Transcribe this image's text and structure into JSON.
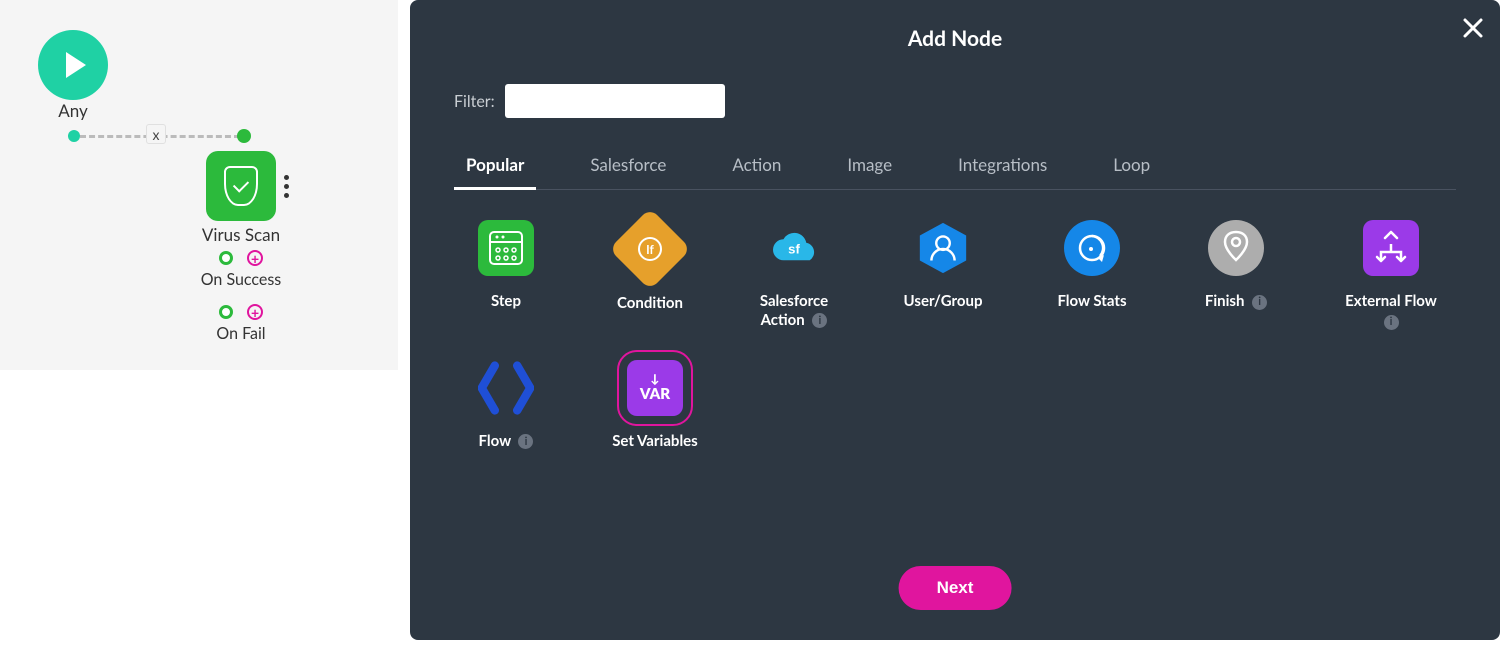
{
  "canvas": {
    "start_label": "Any",
    "connector_x": "x",
    "node_label": "Virus Scan",
    "on_success": "On Success",
    "on_fail": "On Fail"
  },
  "modal": {
    "title": "Add Node",
    "filter_label": "Filter:",
    "filter_value": "",
    "tabs": {
      "popular": "Popular",
      "salesforce": "Salesforce",
      "action": "Action",
      "image": "Image",
      "integrations": "Integrations",
      "loop": "Loop"
    },
    "nodes": {
      "step": "Step",
      "condition": "Condition",
      "sf_action": "Salesforce Action",
      "user_group": "User/Group",
      "flow_stats": "Flow Stats",
      "finish": "Finish",
      "external_flow": "External Flow",
      "flow": "Flow",
      "set_variables": "Set Variables"
    },
    "info_glyph": "i",
    "next": "Next"
  }
}
